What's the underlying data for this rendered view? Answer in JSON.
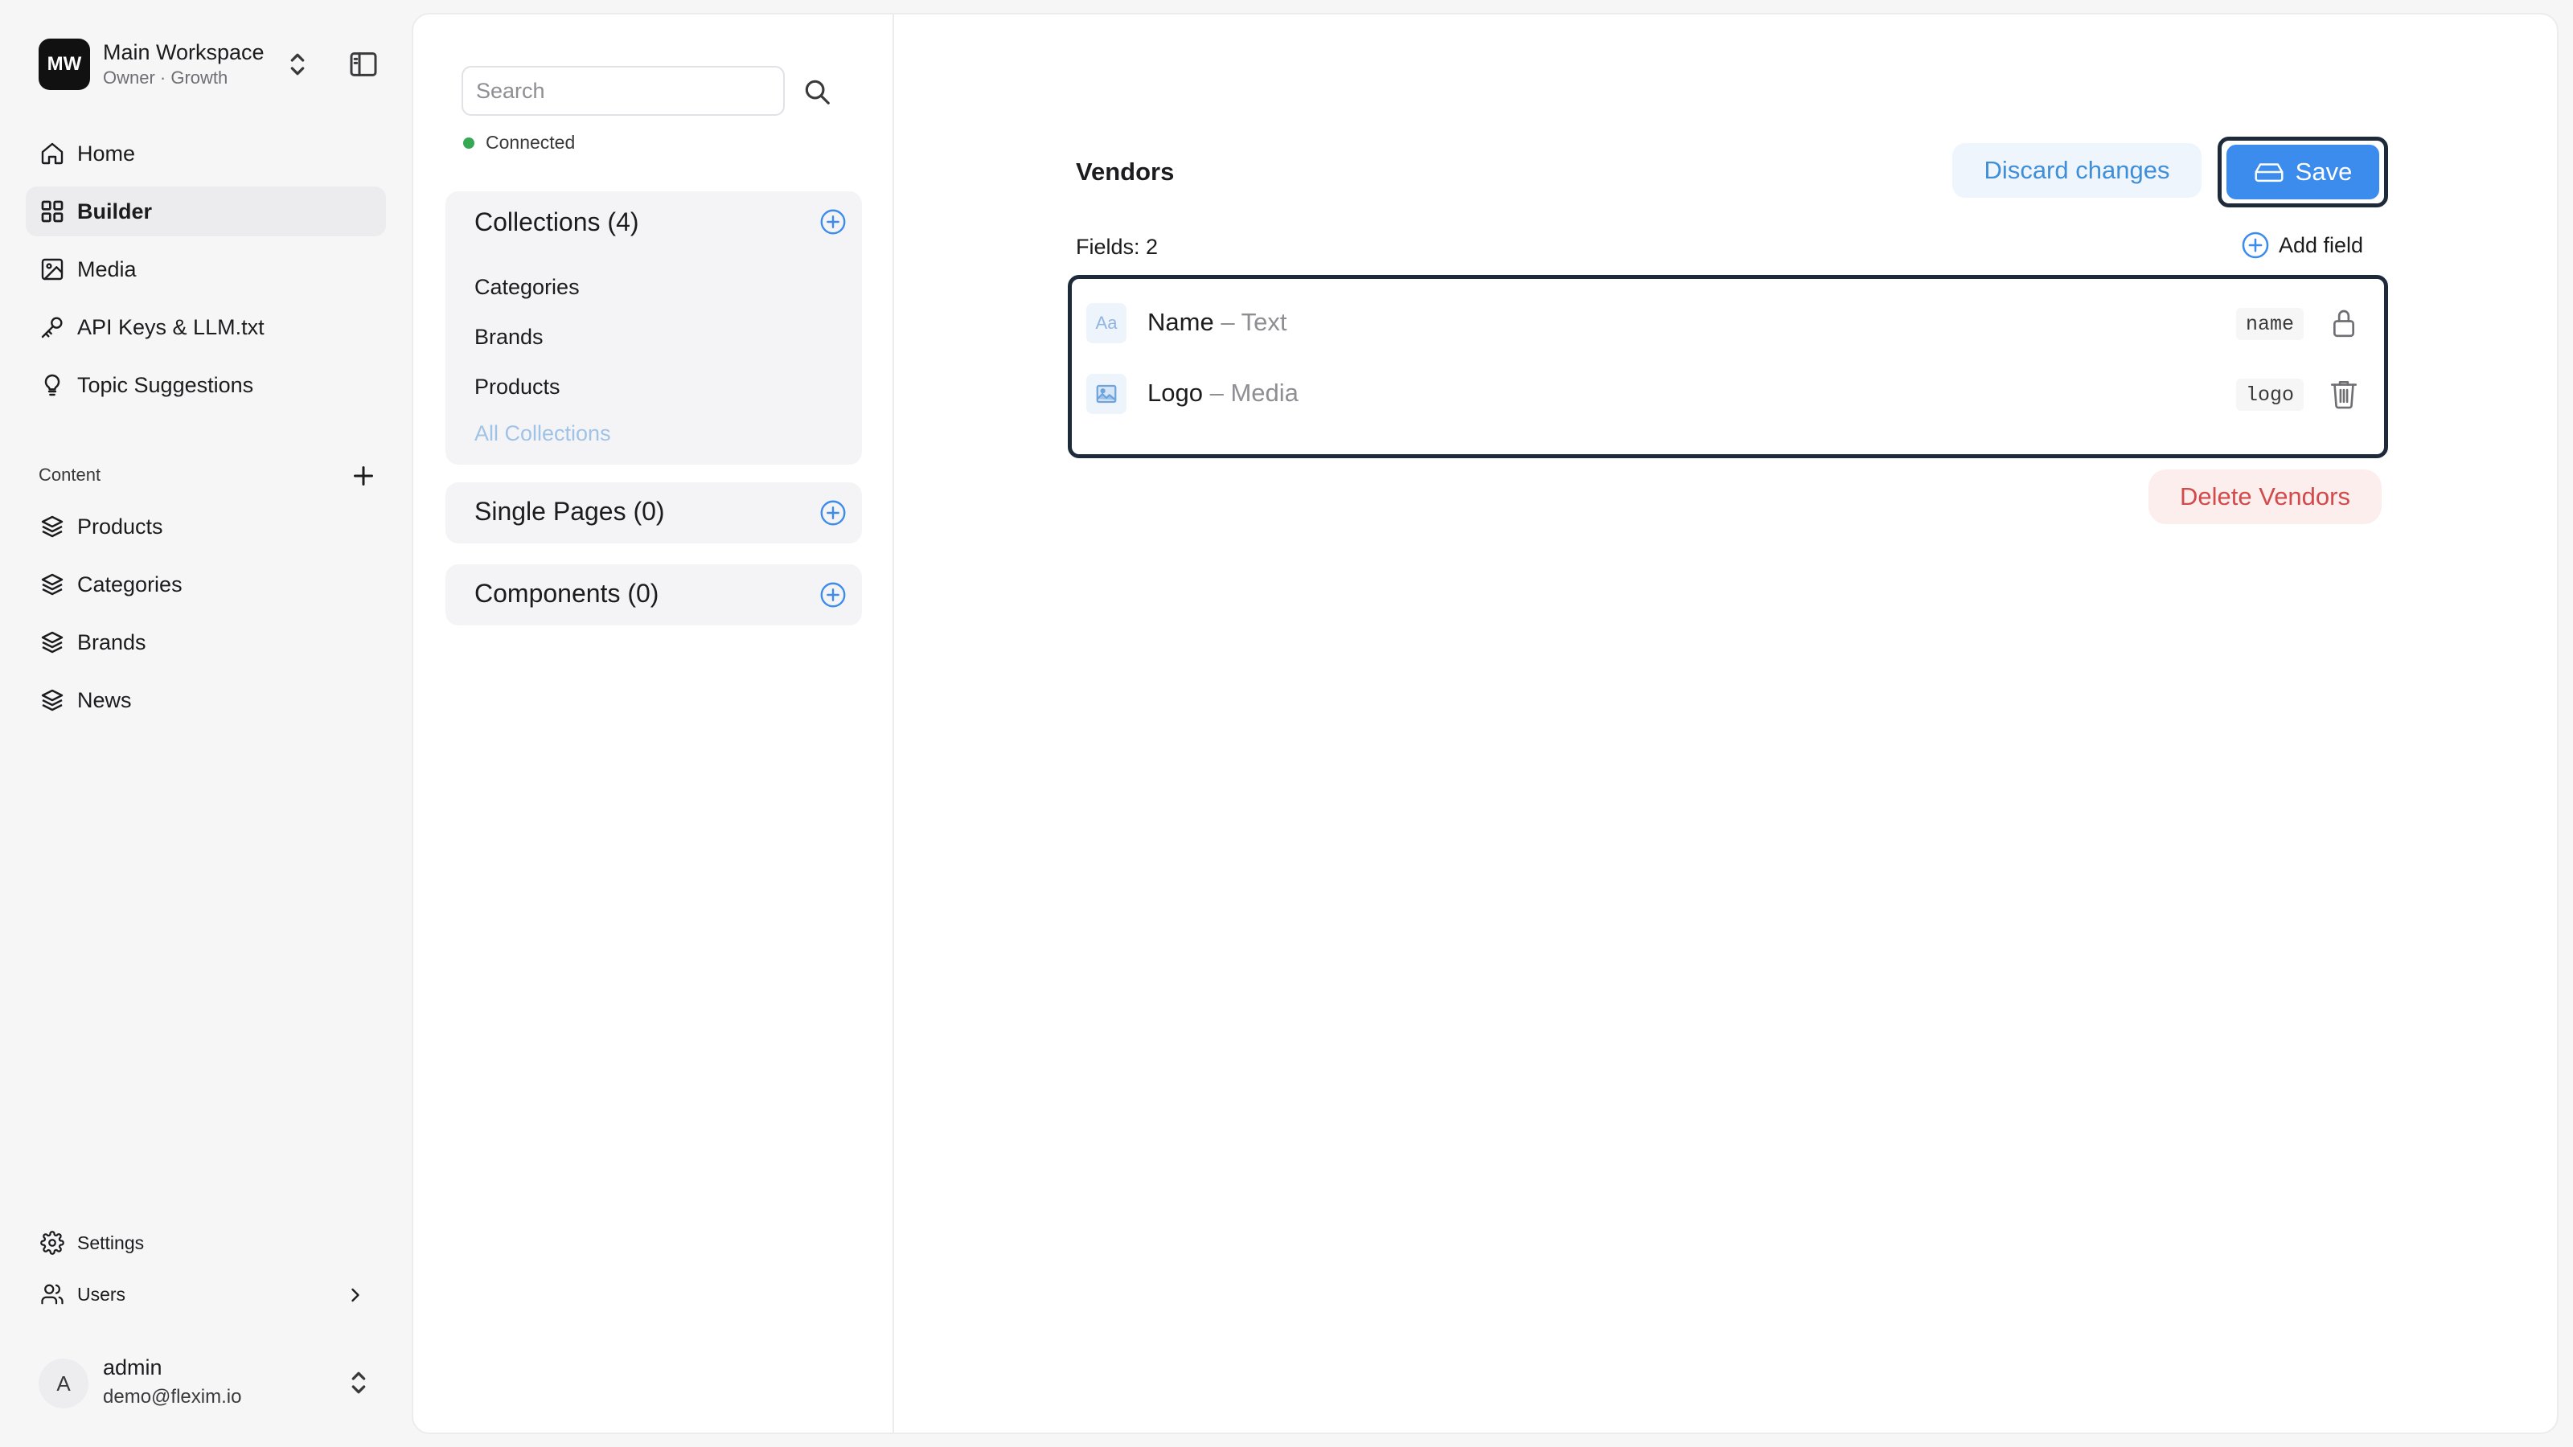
{
  "workspace": {
    "initials": "MW",
    "name": "Main Workspace",
    "subtitle": "Owner · Growth"
  },
  "nav": {
    "items": [
      {
        "label": "Home",
        "icon": "home-icon"
      },
      {
        "label": "Builder",
        "icon": "grid-icon",
        "active": true
      },
      {
        "label": "Media",
        "icon": "image-icon"
      },
      {
        "label": "API Keys & LLM.txt",
        "icon": "key-icon"
      },
      {
        "label": "Topic Suggestions",
        "icon": "lightbulb-icon"
      }
    ],
    "content_heading": "Content",
    "content_items": [
      {
        "label": "Products",
        "icon": "layers-icon"
      },
      {
        "label": "Categories",
        "icon": "layers-icon"
      },
      {
        "label": "Brands",
        "icon": "layers-icon"
      },
      {
        "label": "News",
        "icon": "layers-icon"
      }
    ],
    "settings_label": "Settings",
    "users_label": "Users"
  },
  "user": {
    "initial": "A",
    "name": "admin",
    "email": "demo@flexim.io"
  },
  "builder": {
    "search_placeholder": "Search",
    "status_text": "Connected",
    "status_color": "#34a853",
    "collections": {
      "title": "Collections (4)",
      "items": [
        "Categories",
        "Brands",
        "Products"
      ],
      "all_label": "All Collections"
    },
    "single_pages_title": "Single Pages (0)",
    "components_title": "Components (0)"
  },
  "editor": {
    "title": "Vendors",
    "discard_label": "Discard changes",
    "save_label": "Save",
    "fields_count": "Fields: 2",
    "add_field_label": "Add field",
    "fields": [
      {
        "name": "Name",
        "separator": " – ",
        "type": "Text",
        "key": "name",
        "icon": "text-type-icon",
        "icon_text": "Aa",
        "action_icon": "lock-icon"
      },
      {
        "name": "Logo",
        "separator": " – ",
        "type": "Media",
        "key": "logo",
        "icon": "image-type-icon",
        "action_icon": "trash-icon"
      }
    ],
    "delete_label": "Delete Vendors",
    "accent_color": "#3b8ced",
    "danger_color": "#d24b4b"
  }
}
